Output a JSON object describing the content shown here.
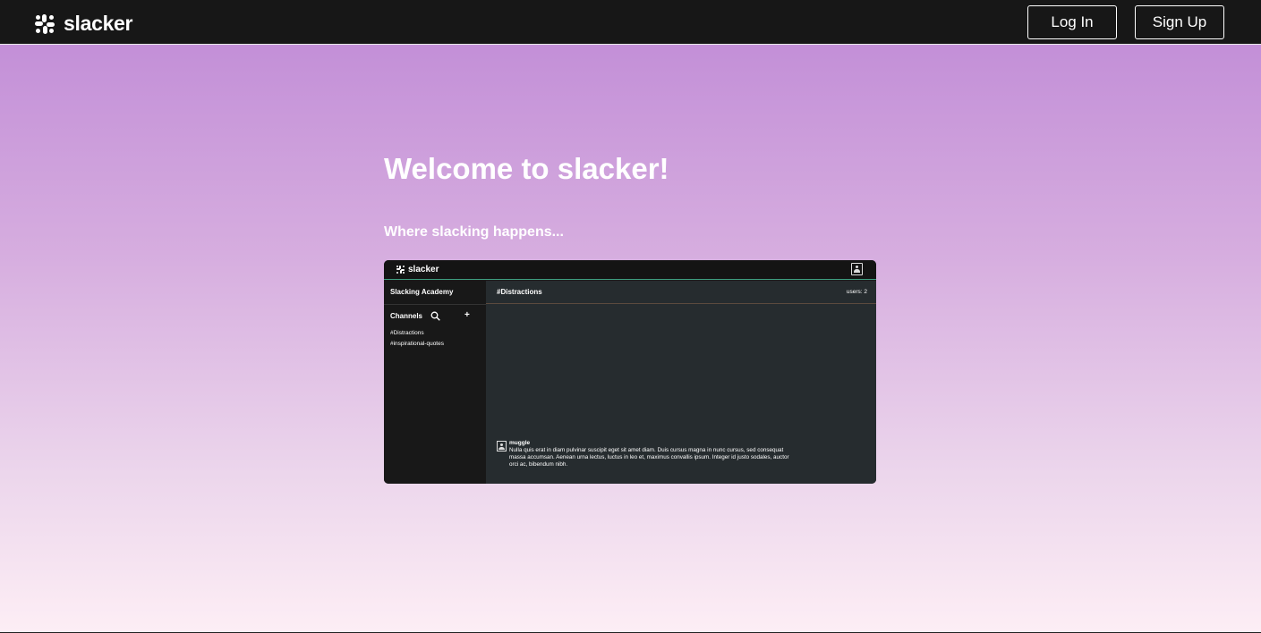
{
  "header": {
    "brand": "slacker",
    "login_label": "Log In",
    "signup_label": "Sign Up"
  },
  "hero": {
    "title": "Welcome to slacker!",
    "subtitle": "Where slacking happens..."
  },
  "preview": {
    "brand": "slacker",
    "workspace": "Slacking Academy",
    "channels_label": "Channels",
    "add_symbol": "+",
    "channels": [
      "#Distractions",
      "#inspirational-quotes"
    ],
    "active_channel": "#Distractions",
    "users_count": "users: 2",
    "message": {
      "user": "muggle",
      "text": "Nulla quis erat in diam pulvinar suscipit eget sit amet diam. Duis cursus magna in nunc cursus, sed consequat massa accumsan. Aenean urna lectus, luctus in leo et, maximus convallis ipsum. Integer id justo sodales, auctor orci ac, bibendum nibh."
    }
  },
  "colors": {
    "topbar": "#171717",
    "gradient_top": "#bf89d6",
    "gradient_bottom": "#fdeef5",
    "preview_sidebar": "#181818",
    "preview_main": "#262c2f"
  }
}
